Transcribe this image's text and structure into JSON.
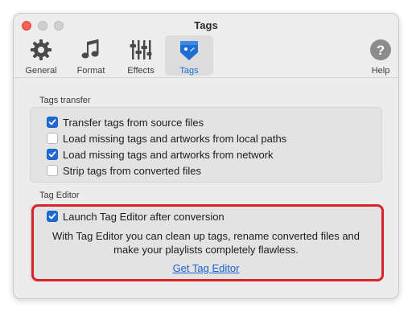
{
  "window": {
    "title": "Tags"
  },
  "toolbar": {
    "items": [
      {
        "label": "General",
        "icon": "gear-icon",
        "selected": false
      },
      {
        "label": "Format",
        "icon": "music-note-icon",
        "selected": false
      },
      {
        "label": "Effects",
        "icon": "sliders-icon",
        "selected": false
      },
      {
        "label": "Tags",
        "icon": "tag-icon",
        "selected": true
      },
      {
        "label": "Help",
        "icon": "question-icon",
        "selected": false
      }
    ],
    "accent_color": "#1a6fd8"
  },
  "tags_transfer": {
    "heading": "Tags transfer",
    "options": [
      {
        "label": "Transfer tags from source files",
        "checked": true
      },
      {
        "label": "Load missing tags and artworks from local paths",
        "checked": false
      },
      {
        "label": "Load missing tags and artworks from network",
        "checked": true
      },
      {
        "label": "Strip tags from converted files",
        "checked": false
      }
    ]
  },
  "tag_editor": {
    "heading": "Tag Editor",
    "launch_option": {
      "label": "Launch Tag Editor after conversion",
      "checked": true
    },
    "description_line1": "With Tag Editor you can clean up tags, rename converted files and",
    "description_line2": "make your playlists completely flawless.",
    "link_label": "Get Tag Editor",
    "highlight_color": "#d9232b"
  }
}
